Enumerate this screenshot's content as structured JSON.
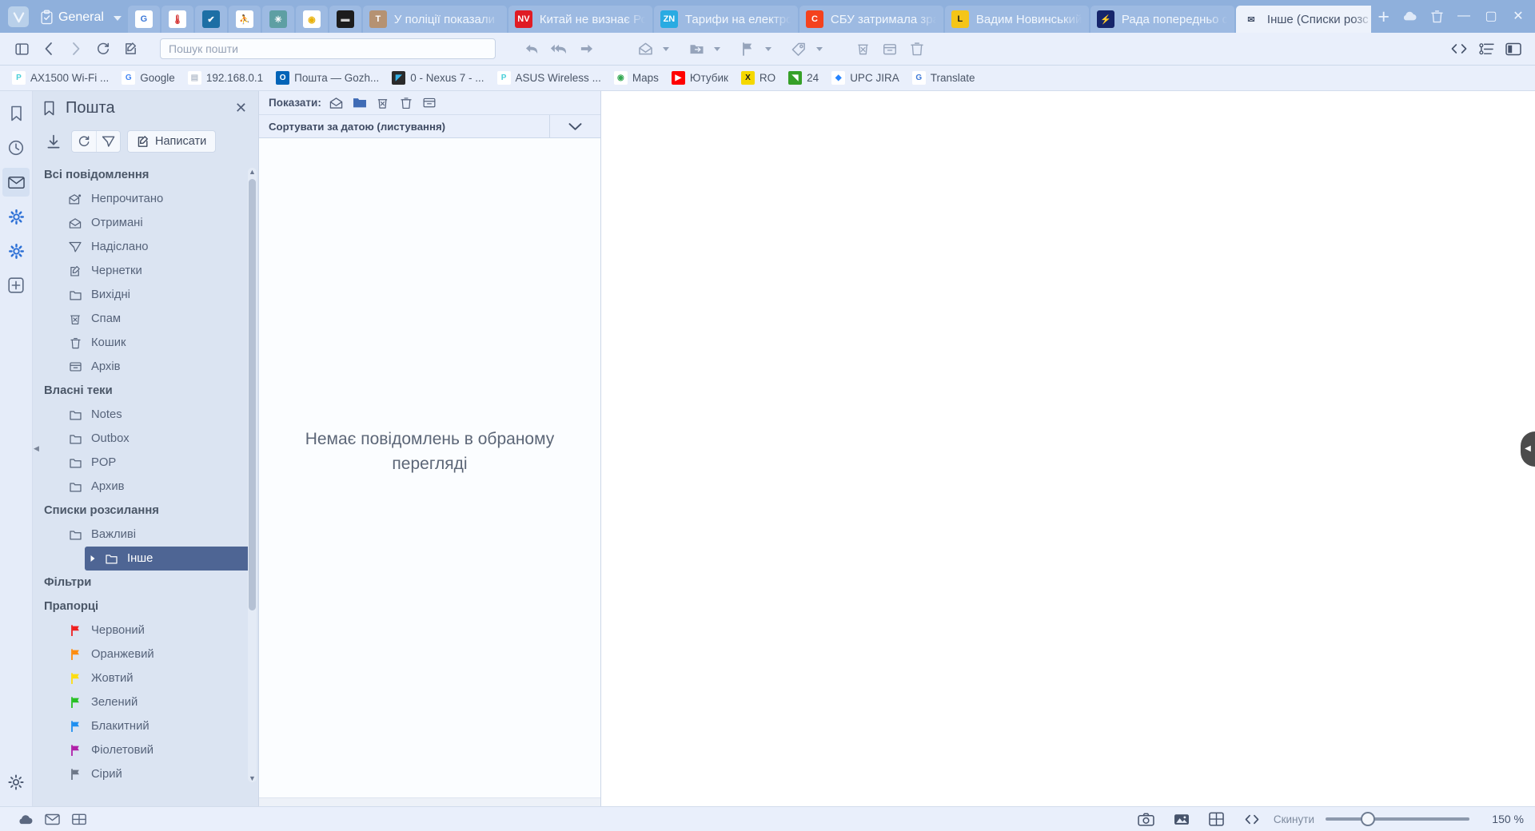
{
  "window": {
    "workspace_label": "General",
    "minimize_label": "—",
    "maximize_label": "▢",
    "close_label": "✕",
    "newtab_label": "+",
    "cloud_icon": "cloud-icon",
    "trash_icon": "trash-icon"
  },
  "tabs": {
    "pinned": [
      {
        "name": "google-translate",
        "glyph": "G",
        "bg": "#ffffff",
        "fg": "#3c78d8"
      },
      {
        "name": "thermometer",
        "glyph": "🌡",
        "bg": "#ffffff",
        "fg": "#d32f2f"
      },
      {
        "name": "checkmark-blue",
        "glyph": "✔",
        "bg": "#1d6fa5",
        "fg": "#ffffff"
      },
      {
        "name": "orange-person",
        "glyph": "⛹",
        "bg": "#ffffff",
        "fg": "#f07f20"
      },
      {
        "name": "teal-star",
        "glyph": "✳",
        "bg": "#5e9fa3",
        "fg": "#ffffff"
      },
      {
        "name": "yellow-circle",
        "glyph": "◉",
        "bg": "#ffffff",
        "fg": "#e8b10a"
      },
      {
        "name": "dark-device",
        "glyph": "▬",
        "bg": "#1c1c1c",
        "fg": "#cfcfcf"
      }
    ],
    "open": [
      {
        "title": "У поліції показали",
        "glyph": "T",
        "bg": "#b59272",
        "fg": "#ffffff",
        "active": false
      },
      {
        "title": "Китай не визнає Ро",
        "glyph": "NV",
        "bg": "#e01b24",
        "fg": "#ffffff",
        "active": false
      },
      {
        "title": "Тарифи на електро",
        "glyph": "ZN",
        "bg": "#29abe2",
        "fg": "#ffffff",
        "active": false
      },
      {
        "title": "СБУ затримала зра",
        "glyph": "C",
        "bg": "#f4421e",
        "fg": "#ffffff",
        "active": false
      },
      {
        "title": "Вадим Новинський",
        "glyph": "L",
        "bg": "#f5c518",
        "fg": "#1a1a1a",
        "active": false
      },
      {
        "title": "Рада попередньо с",
        "glyph": "⚡",
        "bg": "#16256b",
        "fg": "#ffd400",
        "active": false
      },
      {
        "title": "Інше (Списки розс",
        "glyph": "✉",
        "bg": "#edf2fb",
        "fg": "#46536b",
        "active": true
      }
    ]
  },
  "navbar": {
    "panel_toggle": "panel-toggle-icon",
    "back": "back-arrow-icon",
    "forward": "forward-arrow-icon",
    "reload": "reload-icon",
    "compose": "compose-icon",
    "reply": "reply-icon",
    "reply_all": "reply-all-icon",
    "forward_msg": "forward-message-icon",
    "mark_read": "mark-read-icon",
    "move_to_folder": "move-to-folder-icon",
    "flag": "flag-icon",
    "tag": "tag-icon",
    "spam": "mark-spam-icon",
    "archive": "archive-icon",
    "delete": "delete-icon",
    "code": "source-code-icon",
    "structure": "page-structure-icon",
    "right_panel": "right-panel-icon"
  },
  "search": {
    "placeholder": "Пошук пошти",
    "value": ""
  },
  "bookmarks": [
    {
      "label": "AX1500 Wi-Fi ...",
      "icon": "tplink-icon",
      "glyph": "P",
      "bg": "#ffffff",
      "fg": "#4acfd9"
    },
    {
      "label": "Google",
      "icon": "google-icon",
      "glyph": "G",
      "bg": "#ffffff",
      "fg": "#4285f4"
    },
    {
      "label": "192.168.0.1",
      "icon": "document-icon",
      "glyph": "▤",
      "bg": "#ffffff",
      "fg": "#b9c2cf"
    },
    {
      "label": "Пошта — Gozh...",
      "icon": "outlook-icon",
      "glyph": "O",
      "bg": "#0364b8",
      "fg": "#ffffff"
    },
    {
      "label": "0 - Nexus 7 - ...",
      "icon": "device-wifi-icon",
      "glyph": "◤",
      "bg": "#2b2b2b",
      "fg": "#35b3e8"
    },
    {
      "label": "ASUS Wireless ...",
      "icon": "tplink-icon",
      "glyph": "P",
      "bg": "#ffffff",
      "fg": "#4acfd9"
    },
    {
      "label": "Maps",
      "icon": "google-maps-icon",
      "glyph": "◉",
      "bg": "#ffffff",
      "fg": "#34a853"
    },
    {
      "label": "Ютубик",
      "icon": "youtube-icon",
      "glyph": "▶",
      "bg": "#ff0000",
      "fg": "#ffffff"
    },
    {
      "label": "RO",
      "icon": "x-yellow-icon",
      "glyph": "X",
      "bg": "#f5d800",
      "fg": "#1a1a1a"
    },
    {
      "label": "24",
      "icon": "green-arrow-icon",
      "glyph": "◥",
      "bg": "#36a028",
      "fg": "#ffffff"
    },
    {
      "label": "UPC JIRA",
      "icon": "jira-icon",
      "glyph": "◆",
      "bg": "#ffffff",
      "fg": "#2684ff"
    },
    {
      "label": "Translate",
      "icon": "google-translate-icon",
      "glyph": "G",
      "bg": "#ffffff",
      "fg": "#3c78d8"
    }
  ],
  "rail": [
    {
      "name": "bookmarks",
      "icon": "bookmark-icon",
      "selected": false
    },
    {
      "name": "history",
      "icon": "clock-icon",
      "selected": false
    },
    {
      "name": "mail",
      "icon": "envelope-icon",
      "selected": true
    },
    {
      "name": "settings-blue",
      "icon": "gear-blue-icon",
      "selected": false
    },
    {
      "name": "settings-blue-2",
      "icon": "gear-blue-icon",
      "selected": false
    },
    {
      "name": "add-panel",
      "icon": "plus-box-icon",
      "selected": false
    },
    {
      "name": "settings",
      "icon": "gear-icon",
      "selected": false
    }
  ],
  "panel": {
    "title": "Пошта",
    "close_label": "✕",
    "download_icon": "download-icon",
    "refresh_icon": "refresh-icon",
    "send_icon": "send-icon",
    "compose_label": "Написати",
    "compose_icon": "compose-pencil-icon",
    "groups": [
      {
        "title": "Всі повідомлення",
        "items": [
          {
            "label": "Непрочитано",
            "icon": "unread-envelope-icon"
          },
          {
            "label": "Отримані",
            "icon": "inbox-envelope-icon"
          },
          {
            "label": "Надіслано",
            "icon": "sent-paperplane-icon"
          },
          {
            "label": "Чернетки",
            "icon": "draft-pencil-icon"
          },
          {
            "label": "Вихідні",
            "icon": "folder-icon"
          },
          {
            "label": "Спам",
            "icon": "spam-bin-icon"
          },
          {
            "label": "Кошик",
            "icon": "trash-icon"
          },
          {
            "label": "Архів",
            "icon": "archive-box-icon"
          }
        ]
      },
      {
        "title": "Власні теки",
        "items": [
          {
            "label": "Notes",
            "icon": "folder-icon"
          },
          {
            "label": "Outbox",
            "icon": "folder-icon"
          },
          {
            "label": "POP",
            "icon": "folder-icon"
          },
          {
            "label": "Архив",
            "icon": "folder-icon"
          }
        ]
      },
      {
        "title": "Списки розсилання",
        "items": [
          {
            "label": "Важливі",
            "icon": "folder-icon"
          },
          {
            "label": "Інше",
            "icon": "folder-icon",
            "selected": true,
            "expandable": true
          }
        ]
      },
      {
        "title": "Фільтри",
        "items": []
      },
      {
        "title": "Прапорці",
        "items": [
          {
            "label": "Червоний",
            "icon": "flag-icon",
            "color": "#ef2020"
          },
          {
            "label": "Оранжевий",
            "icon": "flag-icon",
            "color": "#fd8c10"
          },
          {
            "label": "Жовтий",
            "icon": "flag-icon",
            "color": "#fddd10"
          },
          {
            "label": "Зелений",
            "icon": "flag-icon",
            "color": "#27c024"
          },
          {
            "label": "Блакитний",
            "icon": "flag-icon",
            "color": "#1f8ff0"
          },
          {
            "label": "Фіолетовий",
            "icon": "flag-icon",
            "color": "#b01fa8"
          },
          {
            "label": "Сірий",
            "icon": "flag-icon",
            "color": "#6d7787"
          }
        ]
      }
    ]
  },
  "message_list": {
    "show_label": "Показати:",
    "show_filters": [
      {
        "name": "unread-filter",
        "icon": "open-envelope-icon",
        "active": false
      },
      {
        "name": "folder-filter",
        "icon": "folder-filled-icon",
        "active": true
      },
      {
        "name": "spam-filter",
        "icon": "spam-bin-icon",
        "active": false
      },
      {
        "name": "trash-filter",
        "icon": "trash-icon",
        "active": false
      },
      {
        "name": "archive-filter",
        "icon": "archive-box-icon",
        "active": false
      }
    ],
    "sort_label": "Сортувати за датою (листування)",
    "sort_caret": "chevron-down-icon",
    "empty_message": "Немає повідомлень в обраному перегляді"
  },
  "statusbar": {
    "cloud_icon": "cloud-sync-icon",
    "mail_icon": "envelope-icon",
    "tiles_icon": "tiles-icon",
    "capture_icon": "camera-icon",
    "image_icon": "image-icon",
    "tile_icon": "tile-grid-icon",
    "devtools_icon": "code-icon",
    "reset_label": "Скинути",
    "zoom_value": "150 %"
  }
}
